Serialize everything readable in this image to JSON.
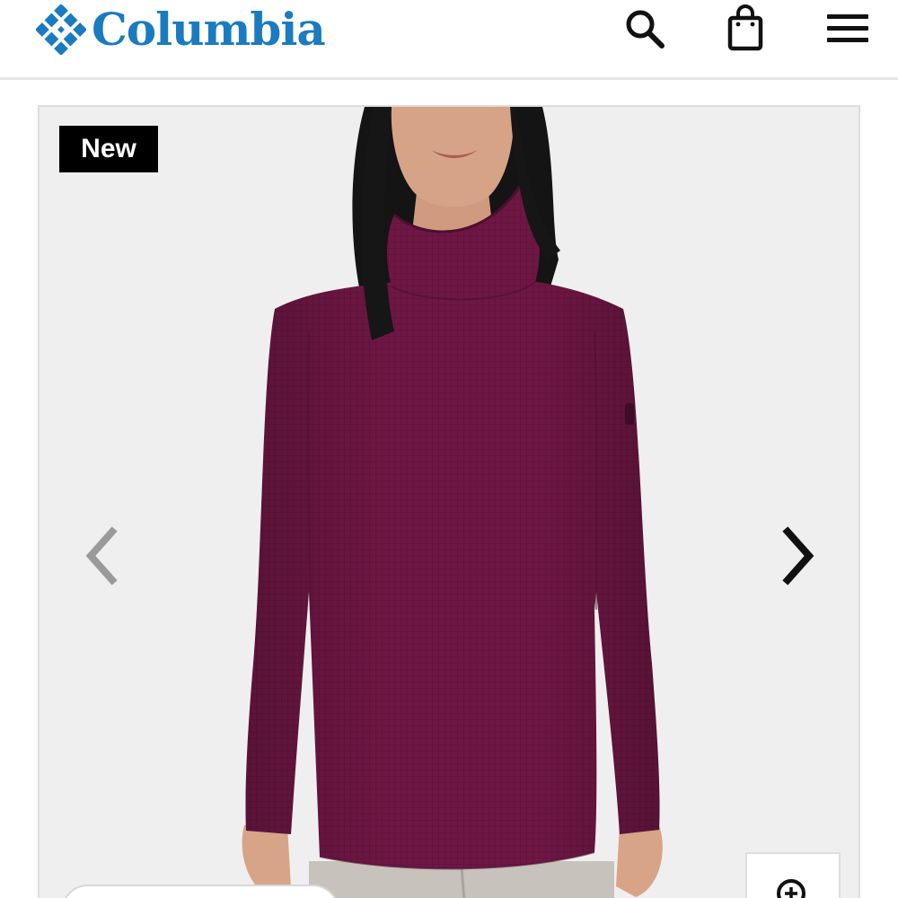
{
  "header": {
    "brand": "Columbia",
    "brand_color": "#1a7bc1",
    "icons": [
      "search-icon",
      "shopping-bag-icon",
      "hamburger-menu-icon"
    ]
  },
  "gallery": {
    "badge": "New",
    "product_color": "#6e1744",
    "icons": [
      "chevron-left-icon",
      "chevron-right-icon",
      "zoom-in-icon"
    ]
  }
}
